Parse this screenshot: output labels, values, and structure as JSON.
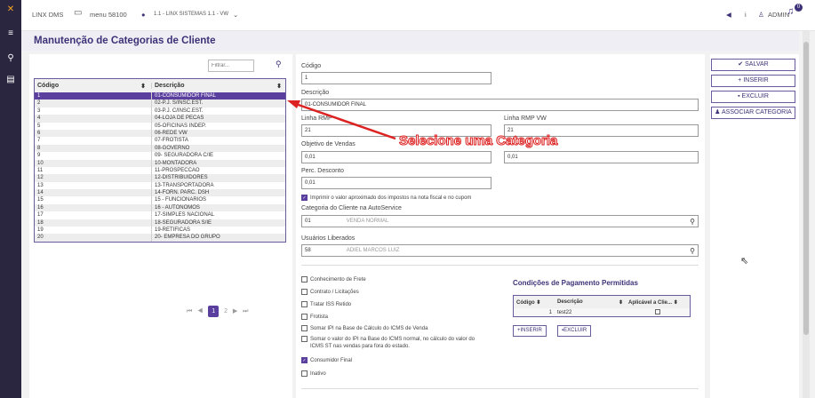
{
  "topbar": {
    "brand": "LINX DMS",
    "menu": "menu 58100",
    "location": "1.1 - LINX SISTEMAS 1.1 - VW",
    "user": "ADMIN",
    "notif_count": "0"
  },
  "page": {
    "title": "Manutenção de Categorias de Cliente"
  },
  "list": {
    "filter_placeholder": "Filtrar...",
    "col1": "Código",
    "col2": "Descrição",
    "rows": [
      {
        "code": "1",
        "desc": "01-CONSUMIDOR FINAL"
      },
      {
        "code": "2",
        "desc": "02-P.J. S/INSC.EST."
      },
      {
        "code": "3",
        "desc": "03-P.J. C/INSC.EST."
      },
      {
        "code": "4",
        "desc": "04-LOJA DE PECAS"
      },
      {
        "code": "5",
        "desc": "05-OFICINAS INDEP."
      },
      {
        "code": "6",
        "desc": "06-REDE VW"
      },
      {
        "code": "7",
        "desc": "07-FROTISTA"
      },
      {
        "code": "8",
        "desc": "08-GOVERNO"
      },
      {
        "code": "9",
        "desc": "09- SEGURADORA C/IE"
      },
      {
        "code": "10",
        "desc": "10-MONTADORA"
      },
      {
        "code": "11",
        "desc": "11-PROSPECCAO"
      },
      {
        "code": "12",
        "desc": "12-DISTRIBUIDORES"
      },
      {
        "code": "13",
        "desc": "13-TRANSPORTADORA"
      },
      {
        "code": "14",
        "desc": "14-FORN. PARC. DSH"
      },
      {
        "code": "15",
        "desc": "15 - FUNCIONARIOS"
      },
      {
        "code": "16",
        "desc": "16 - AUTONOMOS"
      },
      {
        "code": "17",
        "desc": "17-SIMPLES NACIONAL"
      },
      {
        "code": "18",
        "desc": "18-SEGURADORA S/IE"
      },
      {
        "code": "19",
        "desc": "19-RETIFICAS"
      },
      {
        "code": "20",
        "desc": "20- EMPRESA DO GRUPO"
      }
    ],
    "pager": {
      "first": "⏮",
      "prev": "◀",
      "p1": "1",
      "p2": "2",
      "next": "▶",
      "last": "⏭"
    }
  },
  "form": {
    "codigo_label": "Código",
    "codigo": "1",
    "descricao_label": "Descrição",
    "descricao": "01-CONSUMIDOR FINAL",
    "linha_rmp_label": "Linha RMP",
    "linha_rmp": "21",
    "linha_rmp_vw_label": "Linha RMP VW",
    "linha_rmp_vw": "21",
    "objetivo_label": "Objetivo de Vendas",
    "objetivo1": "0,01",
    "objetivo2": "0,01",
    "perc_label": "Perc. Desconto",
    "perc": "0,01",
    "imprimir": "Imprimir o valor aproximado dos impostos na nota fiscal e no cupom",
    "cat_label": "Categoria do Cliente na AutoService",
    "cat_code": "01",
    "cat_desc": "VENDA NORMAL",
    "usr_label": "Usuários Liberados",
    "usr_code": "58",
    "usr_desc": "ADIEL MARCOS LUIZ",
    "checks": [
      {
        "label": "Conhecimento de Frete",
        "on": false
      },
      {
        "label": "Contrato / Licitações",
        "on": false
      },
      {
        "label": "Tratar ISS Retido",
        "on": false
      },
      {
        "label": "Frotista",
        "on": false
      },
      {
        "label": "Somar IPI na Base de Cálculo do ICMS de Venda",
        "on": false
      },
      {
        "label": "Somar o valor do IPI na Base do ICMS normal, no cálculo do valor do",
        "on": false
      },
      {
        "label": "Consumidor Final",
        "on": true
      },
      {
        "label": "Inativo",
        "on": false
      }
    ],
    "check6_line2": "ICMS ST nas vendas para fora do estado."
  },
  "conditions": {
    "title": "Condições de Pagamento Permitidas",
    "h1": "Código",
    "h2": "Descrição",
    "h3": "Aplicável a Clie...",
    "row": {
      "code": "1",
      "desc": "test22"
    },
    "insert": "INSERIR",
    "delete": "EXCLUIR"
  },
  "actions": {
    "save": "SALVAR",
    "insert": "INSERIR",
    "delete": "EXCLUIR",
    "assoc": "ASSOCIAR CATEGORIA"
  },
  "annotation": "Selecione uma Categoria",
  "colors": {
    "accent": "#5a3f9e",
    "sidebar": "#2b2640",
    "annotation": "#dd2222"
  }
}
